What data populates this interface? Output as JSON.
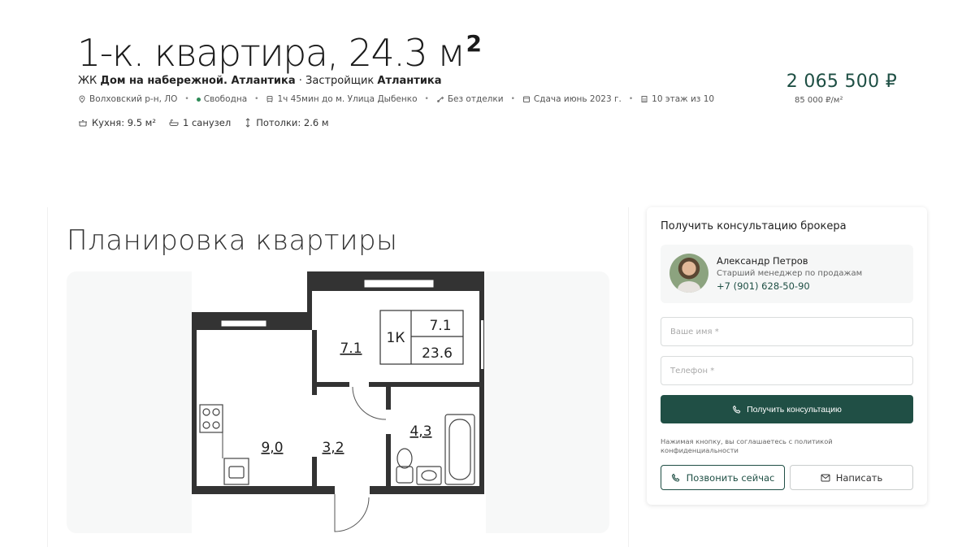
{
  "listing": {
    "title": "1-к. квартира, 24.3 м",
    "title_sup": "2",
    "complex_prefix": "ЖК",
    "complex_name": "Дом на набережной. Атлантика",
    "developer_prefix": "· Застройщик",
    "developer_name": "Атлантика",
    "price": "2 065 500 ₽",
    "price_per_sqm": "85 000 ₽/м²"
  },
  "meta": {
    "location": "Волховский р-н, ЛО",
    "status": "Свободна",
    "metro": "1ч 45мин до м. Улица Дыбенко",
    "finishing": "Без отделки",
    "completion": "Сдача июнь 2023 г.",
    "floor": "10 этаж из 10"
  },
  "features": {
    "kitchen": "Кухня: 9.5 м²",
    "bathroom": "1 санузел",
    "ceiling": "Потолки: 2.6 м"
  },
  "plan": {
    "heading": "Планировка квартиры",
    "rooms": {
      "kitchen": "9,0",
      "hall": "3,2",
      "room": "7.1",
      "bath": "4,3",
      "legend_type": "1К",
      "legend_living": "7.1",
      "legend_total": "23.6"
    }
  },
  "consult": {
    "title": "Получить консультацию брокера",
    "broker_name": "Александр Петров",
    "broker_role": "Старший менеджер по продажам",
    "broker_phone": "+7 (901) 628-50-90",
    "name_placeholder": "Ваше имя *",
    "phone_placeholder": "Телефон *",
    "submit_label": "Получить консультацию",
    "consent_text": "Нажимая кнопку, вы соглашаетесь с политикой конфиденциальности",
    "call_label": "Позвонить сейчас",
    "write_label": "Написать"
  },
  "colors": {
    "accent": "#204f45",
    "status_green": "#2e8b57"
  }
}
